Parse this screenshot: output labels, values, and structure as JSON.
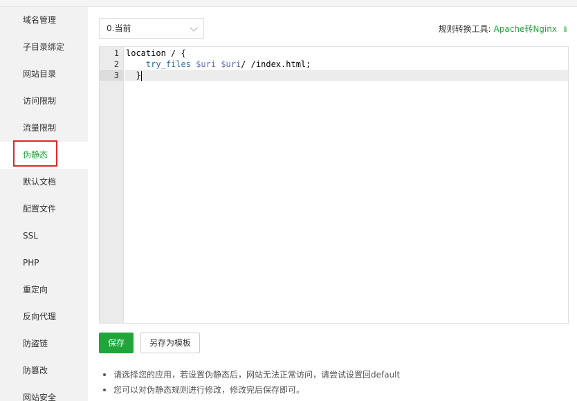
{
  "sidebar": {
    "items": [
      {
        "label": "域名管理"
      },
      {
        "label": "子目录绑定"
      },
      {
        "label": "网站目录"
      },
      {
        "label": "访问限制"
      },
      {
        "label": "流量限制"
      },
      {
        "label": "伪静态",
        "active": true
      },
      {
        "label": "默认文档"
      },
      {
        "label": "配置文件"
      },
      {
        "label": "SSL"
      },
      {
        "label": "PHP"
      },
      {
        "label": "重定向"
      },
      {
        "label": "反向代理"
      },
      {
        "label": "防盗链"
      },
      {
        "label": "防篡改"
      },
      {
        "label": "网站安全"
      }
    ]
  },
  "rewrite": {
    "select_value": "0.当前",
    "tool_label": "规则转换工具:",
    "tool_link": "Apache转Nginx",
    "tool_icon": "paperclip-icon"
  },
  "editor": {
    "line_numbers": [
      "1",
      "2",
      "3"
    ],
    "lines": [
      {
        "t1": "location / {"
      },
      {
        "indent": "    ",
        "fn": "try_files",
        "v1": "$uri",
        "v2": "$uri",
        "rest": "/ /index.html;"
      },
      {
        "indent": "  ",
        "brace": "}"
      }
    ],
    "current_line": 3
  },
  "actions": {
    "save_label": "保存",
    "save_template_label": "另存为模板"
  },
  "tips": [
    "请选择您的应用，若设置伪静态后，网站无法正常访问，请尝试设置回default",
    "您可以对伪静态规则进行修改，修改完后保存即可。"
  ],
  "colors": {
    "accent": "#20a53a",
    "highlight_border": "#e0262a"
  }
}
